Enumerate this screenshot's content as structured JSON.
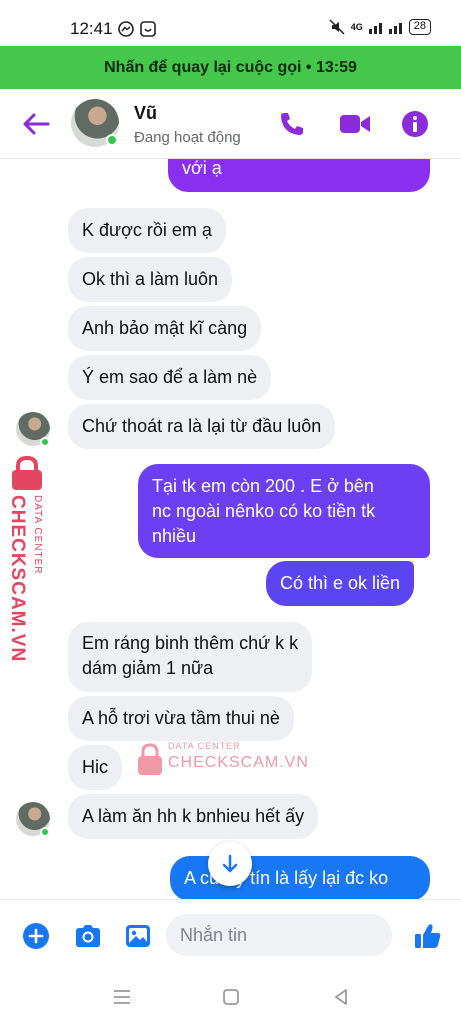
{
  "status_bar": {
    "time": "12:41",
    "battery": "28",
    "network": "4G"
  },
  "call_banner": {
    "text": "Nhấn để quay lại cuộc gọi • 13:59"
  },
  "header": {
    "name": "Vũ",
    "status": "Đang hoạt động"
  },
  "messages": [
    {
      "dir": "out",
      "text": "với ạ"
    },
    {
      "dir": "in",
      "text": "K được rồi em ạ"
    },
    {
      "dir": "in",
      "text": "Ok thì a làm luôn"
    },
    {
      "dir": "in",
      "text": "Anh bảo mật kĩ càng"
    },
    {
      "dir": "in",
      "text": "Ý em sao để a làm nè"
    },
    {
      "dir": "in",
      "text": "Chứ thoát ra là lại từ đầu luôn"
    },
    {
      "dir": "out",
      "line1": "Tại tk em còn 200 . E ở bên",
      "line2": "nc ngoài nênko có ko tiền tk",
      "line3": "nhiều"
    },
    {
      "dir": "out",
      "text": "Có thì e ok liền"
    },
    {
      "dir": "in",
      "line1": "Em ráng binh thêm chứ k k",
      "line2": "dám giảm 1 nữa"
    },
    {
      "dir": "in",
      "text": "A hỗ trơi vừa tầm thui nè"
    },
    {
      "dir": "in",
      "text": "Hic"
    },
    {
      "dir": "in",
      "text": "A làm ăn hh k bnhieu hết ấy"
    },
    {
      "dir": "out",
      "text": "A cứ uy tín là lấy lại đc ko"
    }
  ],
  "watermark": {
    "small": "DATA CENTER",
    "big": "CHECKSCAM.VN"
  },
  "composer": {
    "placeholder": "Nhắn tin"
  },
  "colors": {
    "accent": "#8b2bd9",
    "banner": "#44c74a",
    "out_purple": "#7a3df0",
    "out_blue": "#3d63f5",
    "incoming": "#eeeff2",
    "composer_blue": "#1877f2"
  },
  "icons": [
    "back-arrow-icon",
    "phone-icon",
    "video-icon",
    "info-icon",
    "scroll-down-icon",
    "plus-icon",
    "camera-icon",
    "image-icon",
    "thumbs-up-icon",
    "menu-nav-icon",
    "home-nav-icon",
    "back-nav-icon"
  ]
}
